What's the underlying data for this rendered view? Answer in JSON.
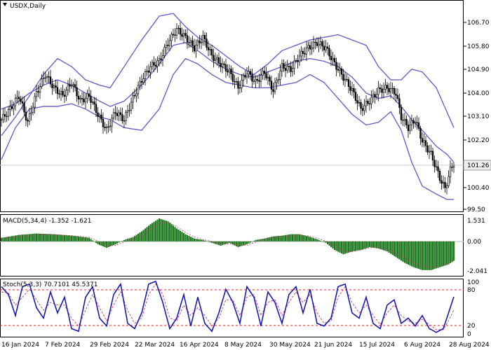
{
  "chart_data": [
    {
      "type": "candlestick",
      "title": "USDX,Daily",
      "price_axis_ticks": [
        "106.70",
        "105.80",
        "104.90",
        "104.00",
        "103.10",
        "102.20",
        "101.30",
        "100.40",
        "99.50"
      ],
      "last_price": "101.26",
      "x_labels": [
        "16 Jan 2024",
        "7 Feb 2024",
        "29 Feb 2024",
        "22 Mar 2024",
        "16 Apr 2024",
        "8 May 2024",
        "30 May 2024",
        "21 Jun 2024",
        "15 Jul 2024",
        "6 Aug 2024",
        "28 Aug 2024"
      ],
      "ylim": [
        99.5,
        107.3
      ],
      "bollinger_upper": [
        [
          0,
          102.3
        ],
        [
          8,
          103.0
        ],
        [
          16,
          103.8
        ],
        [
          24,
          104.6
        ],
        [
          32,
          105.2
        ],
        [
          40,
          104.9
        ],
        [
          48,
          104.4
        ],
        [
          56,
          104.2
        ],
        [
          62,
          104.1
        ],
        [
          70,
          104.9
        ],
        [
          80,
          105.9
        ],
        [
          90,
          106.8
        ],
        [
          98,
          106.9
        ],
        [
          105,
          106.4
        ],
        [
          112,
          106.0
        ],
        [
          120,
          105.7
        ],
        [
          128,
          105.3
        ],
        [
          136,
          104.9
        ],
        [
          144,
          104.6
        ],
        [
          152,
          105.0
        ],
        [
          160,
          105.5
        ],
        [
          168,
          105.7
        ],
        [
          176,
          105.9
        ],
        [
          184,
          106.0
        ],
        [
          192,
          106.1
        ],
        [
          200,
          105.9
        ],
        [
          208,
          105.7
        ],
        [
          215,
          104.9
        ],
        [
          222,
          104.4
        ],
        [
          228,
          104.4
        ],
        [
          234,
          104.8
        ],
        [
          240,
          104.7
        ],
        [
          248,
          104.1
        ],
        [
          254,
          103.2
        ],
        [
          258,
          102.6
        ]
      ],
      "bollinger_middle": [
        [
          0,
          103.3
        ],
        [
          8,
          103.5
        ],
        [
          16,
          103.9
        ],
        [
          24,
          104.2
        ],
        [
          32,
          104.4
        ],
        [
          40,
          104.2
        ],
        [
          48,
          103.9
        ],
        [
          56,
          103.6
        ],
        [
          62,
          103.4
        ],
        [
          70,
          103.6
        ],
        [
          80,
          104.2
        ],
        [
          90,
          105.0
        ],
        [
          98,
          105.7
        ],
        [
          105,
          105.8
        ],
        [
          112,
          105.5
        ],
        [
          120,
          105.1
        ],
        [
          128,
          104.8
        ],
        [
          136,
          104.6
        ],
        [
          144,
          104.5
        ],
        [
          152,
          104.7
        ],
        [
          160,
          104.9
        ],
        [
          168,
          105.1
        ],
        [
          176,
          105.2
        ],
        [
          184,
          105.1
        ],
        [
          192,
          104.9
        ],
        [
          200,
          104.5
        ],
        [
          208,
          103.9
        ],
        [
          215,
          103.7
        ],
        [
          222,
          103.8
        ],
        [
          228,
          103.4
        ],
        [
          234,
          102.9
        ],
        [
          240,
          102.5
        ],
        [
          248,
          101.9
        ],
        [
          254,
          101.6
        ],
        [
          258,
          101.3
        ]
      ],
      "bollinger_lower": [
        [
          0,
          101.4
        ],
        [
          8,
          102.6
        ],
        [
          16,
          103.3
        ],
        [
          24,
          103.4
        ],
        [
          32,
          103.4
        ],
        [
          40,
          103.5
        ],
        [
          48,
          103.3
        ],
        [
          56,
          103.0
        ],
        [
          62,
          102.9
        ],
        [
          70,
          102.6
        ],
        [
          80,
          102.5
        ],
        [
          90,
          103.3
        ],
        [
          98,
          104.6
        ],
        [
          105,
          105.2
        ],
        [
          112,
          105.0
        ],
        [
          120,
          104.6
        ],
        [
          128,
          104.3
        ],
        [
          136,
          104.2
        ],
        [
          144,
          104.1
        ],
        [
          152,
          104.1
        ],
        [
          160,
          104.2
        ],
        [
          168,
          104.3
        ],
        [
          176,
          104.6
        ],
        [
          184,
          104.3
        ],
        [
          192,
          103.7
        ],
        [
          200,
          103.1
        ],
        [
          208,
          102.7
        ],
        [
          215,
          102.8
        ],
        [
          222,
          103.2
        ],
        [
          228,
          102.5
        ],
        [
          234,
          101.3
        ],
        [
          240,
          100.4
        ],
        [
          248,
          100.1
        ],
        [
          254,
          99.9
        ],
        [
          258,
          99.9
        ]
      ],
      "close_path": [
        [
          0,
          102.9
        ],
        [
          5,
          103.3
        ],
        [
          10,
          103.8
        ],
        [
          15,
          102.8
        ],
        [
          20,
          103.9
        ],
        [
          25,
          104.6
        ],
        [
          30,
          104.1
        ],
        [
          35,
          103.8
        ],
        [
          40,
          104.3
        ],
        [
          45,
          103.6
        ],
        [
          50,
          103.8
        ],
        [
          55,
          103.1
        ],
        [
          60,
          102.5
        ],
        [
          65,
          103.2
        ],
        [
          70,
          102.9
        ],
        [
          75,
          103.7
        ],
        [
          80,
          104.4
        ],
        [
          85,
          104.9
        ],
        [
          90,
          105.1
        ],
        [
          95,
          105.8
        ],
        [
          100,
          106.3
        ],
        [
          105,
          106.0
        ],
        [
          110,
          105.6
        ],
        [
          115,
          106.0
        ],
        [
          120,
          105.3
        ],
        [
          125,
          105.0
        ],
        [
          130,
          104.7
        ],
        [
          135,
          104.1
        ],
        [
          140,
          104.7
        ],
        [
          145,
          104.3
        ],
        [
          150,
          104.7
        ],
        [
          155,
          104.0
        ],
        [
          160,
          104.9
        ],
        [
          165,
          104.8
        ],
        [
          170,
          105.3
        ],
        [
          175,
          105.6
        ],
        [
          180,
          105.8
        ],
        [
          185,
          105.6
        ],
        [
          190,
          105.0
        ],
        [
          195,
          104.5
        ],
        [
          200,
          104.0
        ],
        [
          205,
          103.3
        ],
        [
          210,
          103.6
        ],
        [
          215,
          104.0
        ],
        [
          220,
          104.1
        ],
        [
          225,
          103.9
        ],
        [
          228,
          103.0
        ],
        [
          232,
          102.6
        ],
        [
          236,
          102.9
        ],
        [
          240,
          102.1
        ],
        [
          245,
          101.6
        ],
        [
          250,
          100.7
        ],
        [
          253,
          100.3
        ],
        [
          256,
          101.0
        ],
        [
          258,
          101.26
        ]
      ],
      "macd": {
        "label": "MACD(5,34,4)",
        "value1": "-1.352",
        "value2": "-1.621",
        "ticks": [
          "1.531",
          "0.00",
          "-2.041"
        ],
        "ylim": [
          -2.3,
          1.7
        ]
      },
      "macd_hist": [
        [
          0,
          0.25
        ],
        [
          10,
          0.45
        ],
        [
          20,
          0.55
        ],
        [
          30,
          0.5
        ],
        [
          40,
          0.4
        ],
        [
          50,
          0.25
        ],
        [
          55,
          -0.2
        ],
        [
          60,
          -0.45
        ],
        [
          65,
          -0.2
        ],
        [
          70,
          0.1
        ],
        [
          75,
          0.3
        ],
        [
          80,
          0.7
        ],
        [
          85,
          1.2
        ],
        [
          90,
          1.6
        ],
        [
          95,
          1.4
        ],
        [
          100,
          0.9
        ],
        [
          105,
          0.5
        ],
        [
          110,
          0.2
        ],
        [
          115,
          0.1
        ],
        [
          120,
          -0.1
        ],
        [
          125,
          -0.3
        ],
        [
          130,
          -0.1
        ],
        [
          135,
          -0.4
        ],
        [
          140,
          -0.2
        ],
        [
          145,
          0.1
        ],
        [
          150,
          0.2
        ],
        [
          155,
          0.35
        ],
        [
          160,
          0.4
        ],
        [
          165,
          0.5
        ],
        [
          170,
          0.5
        ],
        [
          175,
          0.35
        ],
        [
          180,
          0.15
        ],
        [
          185,
          -0.1
        ],
        [
          190,
          -0.6
        ],
        [
          195,
          -0.9
        ],
        [
          200,
          -0.7
        ],
        [
          205,
          -0.6
        ],
        [
          210,
          -0.4
        ],
        [
          215,
          -0.5
        ],
        [
          220,
          -0.7
        ],
        [
          225,
          -1.1
        ],
        [
          230,
          -1.5
        ],
        [
          235,
          -1.8
        ],
        [
          240,
          -2.0
        ],
        [
          245,
          -2.0
        ],
        [
          250,
          -1.8
        ],
        [
          255,
          -1.6
        ],
        [
          258,
          -1.352
        ]
      ],
      "stoch": {
        "label": "Stoch(5,3,3)",
        "k_value": "70.7101",
        "d_value": "45.5371",
        "ticks": [
          "100",
          "80",
          "20",
          "0"
        ],
        "levels": [
          80,
          20
        ]
      },
      "stoch_k": [
        [
          0,
          90
        ],
        [
          4,
          75
        ],
        [
          8,
          35
        ],
        [
          12,
          90
        ],
        [
          16,
          95
        ],
        [
          20,
          50
        ],
        [
          24,
          30
        ],
        [
          28,
          80
        ],
        [
          32,
          40
        ],
        [
          36,
          70
        ],
        [
          40,
          10
        ],
        [
          44,
          5
        ],
        [
          48,
          70
        ],
        [
          52,
          90
        ],
        [
          56,
          30
        ],
        [
          60,
          15
        ],
        [
          64,
          75
        ],
        [
          68,
          95
        ],
        [
          72,
          20
        ],
        [
          76,
          10
        ],
        [
          80,
          40
        ],
        [
          84,
          95
        ],
        [
          88,
          100
        ],
        [
          92,
          60
        ],
        [
          96,
          10
        ],
        [
          100,
          30
        ],
        [
          104,
          75
        ],
        [
          108,
          15
        ],
        [
          112,
          70
        ],
        [
          116,
          20
        ],
        [
          120,
          5
        ],
        [
          124,
          40
        ],
        [
          128,
          85
        ],
        [
          132,
          60
        ],
        [
          136,
          20
        ],
        [
          140,
          90
        ],
        [
          144,
          70
        ],
        [
          148,
          15
        ],
        [
          152,
          80
        ],
        [
          156,
          60
        ],
        [
          160,
          20
        ],
        [
          164,
          75
        ],
        [
          168,
          90
        ],
        [
          172,
          40
        ],
        [
          176,
          85
        ],
        [
          180,
          20
        ],
        [
          184,
          15
        ],
        [
          188,
          30
        ],
        [
          192,
          90
        ],
        [
          196,
          95
        ],
        [
          200,
          40
        ],
        [
          204,
          30
        ],
        [
          208,
          70
        ],
        [
          212,
          20
        ],
        [
          216,
          10
        ],
        [
          220,
          55
        ],
        [
          224,
          65
        ],
        [
          228,
          20
        ],
        [
          232,
          30
        ],
        [
          236,
          15
        ],
        [
          240,
          35
        ],
        [
          244,
          10
        ],
        [
          248,
          3
        ],
        [
          252,
          10
        ],
        [
          255,
          40
        ],
        [
          258,
          70.7101
        ]
      ],
      "stoch_d": [
        [
          0,
          80
        ],
        [
          4,
          78
        ],
        [
          8,
          55
        ],
        [
          12,
          70
        ],
        [
          16,
          85
        ],
        [
          20,
          65
        ],
        [
          24,
          45
        ],
        [
          28,
          60
        ],
        [
          32,
          55
        ],
        [
          36,
          55
        ],
        [
          40,
          30
        ],
        [
          44,
          15
        ],
        [
          48,
          45
        ],
        [
          52,
          75
        ],
        [
          56,
          50
        ],
        [
          60,
          25
        ],
        [
          64,
          55
        ],
        [
          68,
          80
        ],
        [
          72,
          45
        ],
        [
          76,
          20
        ],
        [
          80,
          30
        ],
        [
          84,
          75
        ],
        [
          88,
          95
        ],
        [
          92,
          75
        ],
        [
          96,
          30
        ],
        [
          100,
          25
        ],
        [
          104,
          55
        ],
        [
          108,
          35
        ],
        [
          112,
          50
        ],
        [
          116,
          35
        ],
        [
          120,
          15
        ],
        [
          124,
          30
        ],
        [
          128,
          65
        ],
        [
          132,
          65
        ],
        [
          136,
          35
        ],
        [
          140,
          70
        ],
        [
          144,
          75
        ],
        [
          148,
          35
        ],
        [
          152,
          60
        ],
        [
          156,
          65
        ],
        [
          160,
          35
        ],
        [
          164,
          60
        ],
        [
          168,
          80
        ],
        [
          172,
          60
        ],
        [
          176,
          75
        ],
        [
          180,
          40
        ],
        [
          184,
          20
        ],
        [
          188,
          25
        ],
        [
          192,
          70
        ],
        [
          196,
          90
        ],
        [
          200,
          60
        ],
        [
          204,
          40
        ],
        [
          208,
          55
        ],
        [
          212,
          35
        ],
        [
          216,
          18
        ],
        [
          220,
          40
        ],
        [
          224,
          55
        ],
        [
          228,
          35
        ],
        [
          232,
          25
        ],
        [
          236,
          20
        ],
        [
          240,
          28
        ],
        [
          244,
          18
        ],
        [
          248,
          8
        ],
        [
          252,
          8
        ],
        [
          255,
          25
        ],
        [
          258,
          45.5371
        ]
      ]
    }
  ],
  "colors": {
    "band": "#6a62c6",
    "candle": "#000000",
    "macd_bar": "#1f7a1f",
    "macd_signal": "#c8386b",
    "stoch_k": "#1a1aa8",
    "stoch_d": "#c8386b",
    "level": "#c83232",
    "grid": "#d8d8d8"
  }
}
